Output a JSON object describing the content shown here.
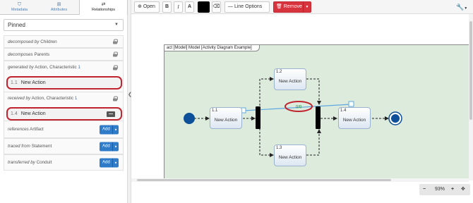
{
  "tabs": [
    {
      "label": "Metadata",
      "icon": "tags-icon"
    },
    {
      "label": "Attributes",
      "icon": "sitemap-icon"
    },
    {
      "label": "Relationships",
      "icon": "arrows-exchange-icon"
    }
  ],
  "pinned": {
    "label": "Pinned"
  },
  "relations": [
    {
      "type": "decomposed by",
      "target": "Children",
      "count": "",
      "kind": "locked"
    },
    {
      "type": "decomposes",
      "target": "Parents",
      "count": "",
      "kind": "locked"
    },
    {
      "type": "generated by",
      "target": "Action, Characteristic",
      "count": "1",
      "kind": "locked"
    },
    {
      "id": "1.1",
      "name": "New Action",
      "kind": "item"
    },
    {
      "type": "received by",
      "target": "Action, Characteristic",
      "count": "1",
      "kind": "locked"
    },
    {
      "id": "1.4",
      "name": "New Action",
      "kind": "item"
    },
    {
      "type": "references",
      "target": "Artifact",
      "count": "",
      "kind": "add"
    },
    {
      "type": "traced from",
      "target": "Statement",
      "count": "",
      "kind": "add"
    },
    {
      "type": "transferred by",
      "target": "Conduit",
      "count": "",
      "kind": "add"
    }
  ],
  "add_label": "Add",
  "toolbar": {
    "open": "Open",
    "bold": "B",
    "italic": "I",
    "font_color": "A",
    "line_options": "Line Options",
    "remove": "Remove"
  },
  "diagram": {
    "frame_title": "act [Model] Model [Activity Diagram Example]",
    "edge_label": "0/0",
    "nodes": [
      {
        "id": "1.1",
        "label": "New Action"
      },
      {
        "id": "1.2",
        "label": "New Action"
      },
      {
        "id": "1.3",
        "label": "New Action"
      },
      {
        "id": "1.4",
        "label": "New Action"
      }
    ]
  },
  "zoom": {
    "value": "93%",
    "minus": "−",
    "plus": "+"
  },
  "colors": {
    "accent": "#2f7bc8",
    "danger": "#d8343e",
    "highlight": "#c0242e",
    "frame_bg": "#dcebdc",
    "node_dot": "#0d4f99",
    "flow_line": "#5fa8e0"
  }
}
